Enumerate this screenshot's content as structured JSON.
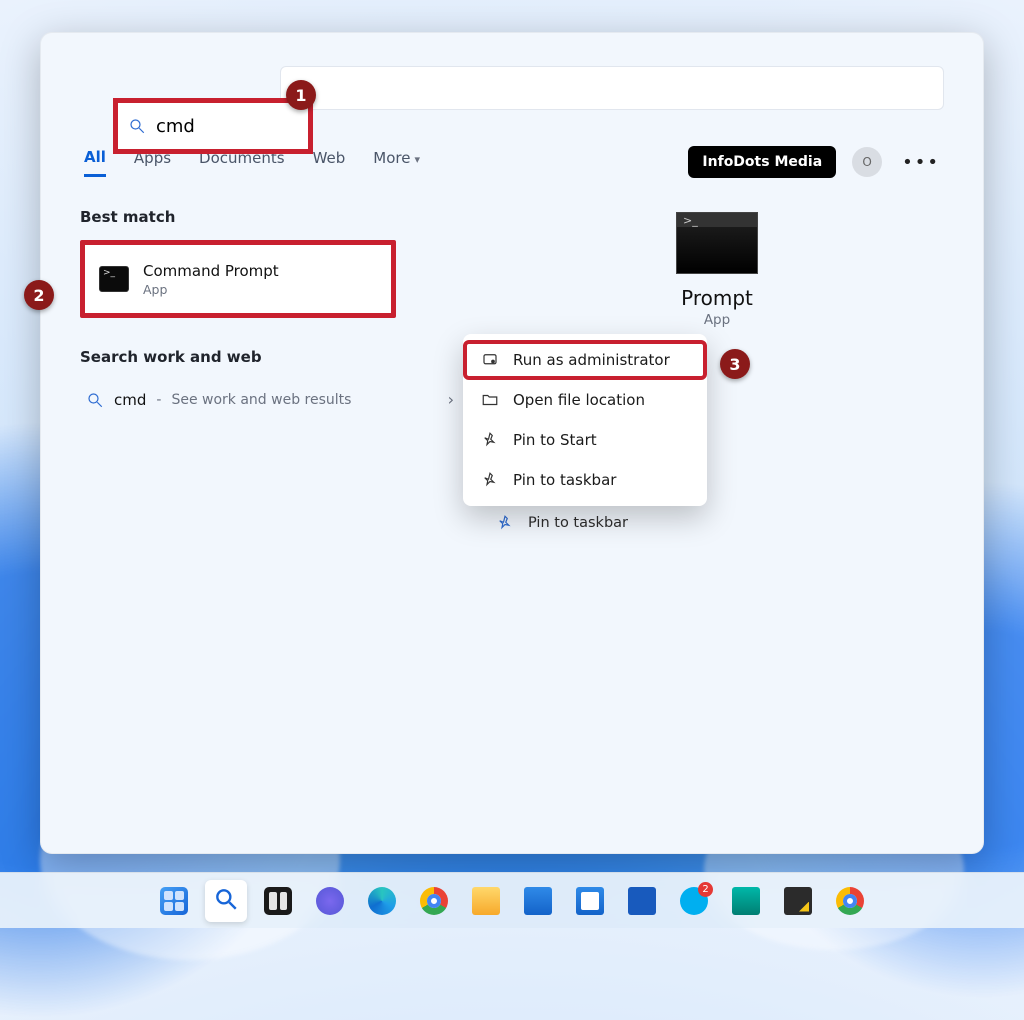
{
  "search": {
    "query": "cmd"
  },
  "tabs": {
    "all": "All",
    "apps": "Apps",
    "documents": "Documents",
    "web": "Web",
    "more": "More"
  },
  "user": {
    "name": "InfoDots Media",
    "initial": "O"
  },
  "sections": {
    "best_match": "Best match",
    "search_web": "Search work and web"
  },
  "best_match": {
    "title": "Command Prompt",
    "subtitle": "App"
  },
  "web_result": {
    "query": "cmd",
    "separator": " - ",
    "hint": "See work and web results"
  },
  "preview": {
    "title_suffix": "Prompt",
    "subtitle": "App"
  },
  "actions": {
    "open_file_location": "Open file location",
    "pin_to_start": "Pin to Start",
    "pin_to_taskbar": "Pin to taskbar"
  },
  "context_menu": {
    "run_as_admin": "Run as administrator",
    "open_file_location": "Open file location",
    "pin_to_start": "Pin to Start",
    "pin_to_taskbar": "Pin to taskbar"
  },
  "annotations": {
    "1": "1",
    "2": "2",
    "3": "3"
  },
  "taskbar": {
    "skype_badge": "2"
  }
}
